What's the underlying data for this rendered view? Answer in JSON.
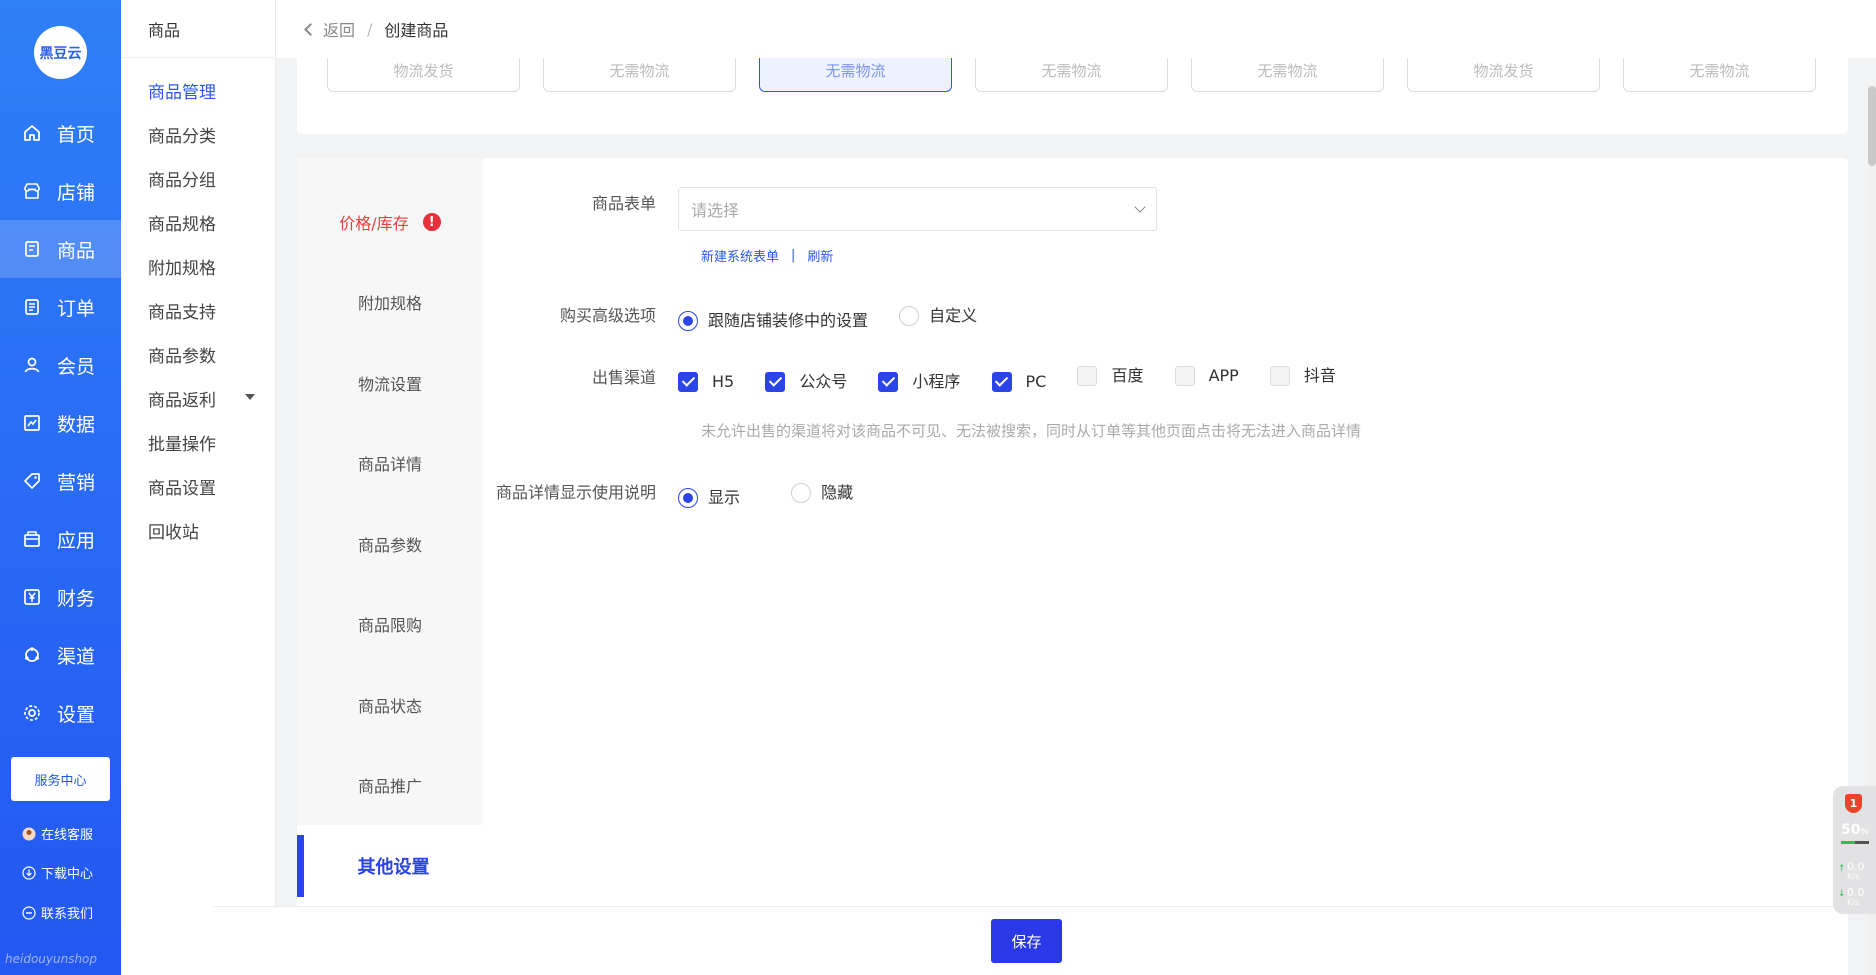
{
  "brand": {
    "logo_text": "黑豆云",
    "watermark": "heidouyunshop"
  },
  "nav_primary": [
    {
      "label": "首页",
      "icon": "home-icon"
    },
    {
      "label": "店铺",
      "icon": "store-icon"
    },
    {
      "label": "商品",
      "icon": "goods-icon",
      "active": true
    },
    {
      "label": "订单",
      "icon": "order-icon"
    },
    {
      "label": "会员",
      "icon": "user-icon"
    },
    {
      "label": "数据",
      "icon": "chart-icon"
    },
    {
      "label": "营销",
      "icon": "tag-icon"
    },
    {
      "label": "应用",
      "icon": "box-icon"
    },
    {
      "label": "财务",
      "icon": "yen-icon"
    },
    {
      "label": "渠道",
      "icon": "channel-icon"
    },
    {
      "label": "设置",
      "icon": "gear-icon"
    }
  ],
  "side_extra": {
    "service_center": "服务中心",
    "online_service": "在线客服",
    "download_center": "下载中心",
    "contact_us": "联系我们"
  },
  "nav_secondary": {
    "title": "商品",
    "items": [
      "商品管理",
      "商品分类",
      "商品分组",
      "商品规格",
      "附加规格",
      "商品支持",
      "商品参数",
      "商品返利",
      "批量操作",
      "商品设置",
      "回收站"
    ]
  },
  "topbar": {
    "back_label": "返回",
    "separator": "/",
    "current": "创建商品"
  },
  "chips": [
    "物流发货",
    "无需物流",
    "无需物流",
    "无需物流",
    "无需物流",
    "物流发货",
    "无需物流"
  ],
  "vtabs": {
    "items": [
      "价格/库存",
      "附加规格",
      "物流设置",
      "商品详情",
      "商品参数",
      "商品限购",
      "商品状态",
      "商品推广"
    ],
    "error_mark": "!",
    "active": "其他设置"
  },
  "form": {
    "form_select": {
      "label": "商品表单",
      "placeholder": "请选择",
      "link_new": "新建系统表单",
      "link_sep": "|",
      "link_refresh": "刷新"
    },
    "purchase_advanced": {
      "label": "购买高级选项",
      "options": [
        "跟随店铺装修中的设置",
        "自定义"
      ],
      "selected": 0
    },
    "sales_channels": {
      "label": "出售渠道",
      "options": [
        {
          "name": "H5",
          "checked": true
        },
        {
          "name": "公众号",
          "checked": true
        },
        {
          "name": "小程序",
          "checked": true
        },
        {
          "name": "PC",
          "checked": true
        },
        {
          "name": "百度",
          "checked": false
        },
        {
          "name": "APP",
          "checked": false
        },
        {
          "name": "抖音",
          "checked": false
        }
      ],
      "hint": "未允许出售的渠道将对该商品不可见、无法被搜索，同时从订单等其他页面点击将无法进入商品详情"
    },
    "detail_instructions": {
      "label": "商品详情显示使用说明",
      "options": [
        "显示",
        "隐藏"
      ],
      "selected": 0
    }
  },
  "footer": {
    "save_label": "保存"
  },
  "perf_widget": {
    "badge": "1",
    "percent": "50",
    "percent_unit": "%",
    "up": "0.0",
    "down": "0.0",
    "unit": "K/s"
  }
}
